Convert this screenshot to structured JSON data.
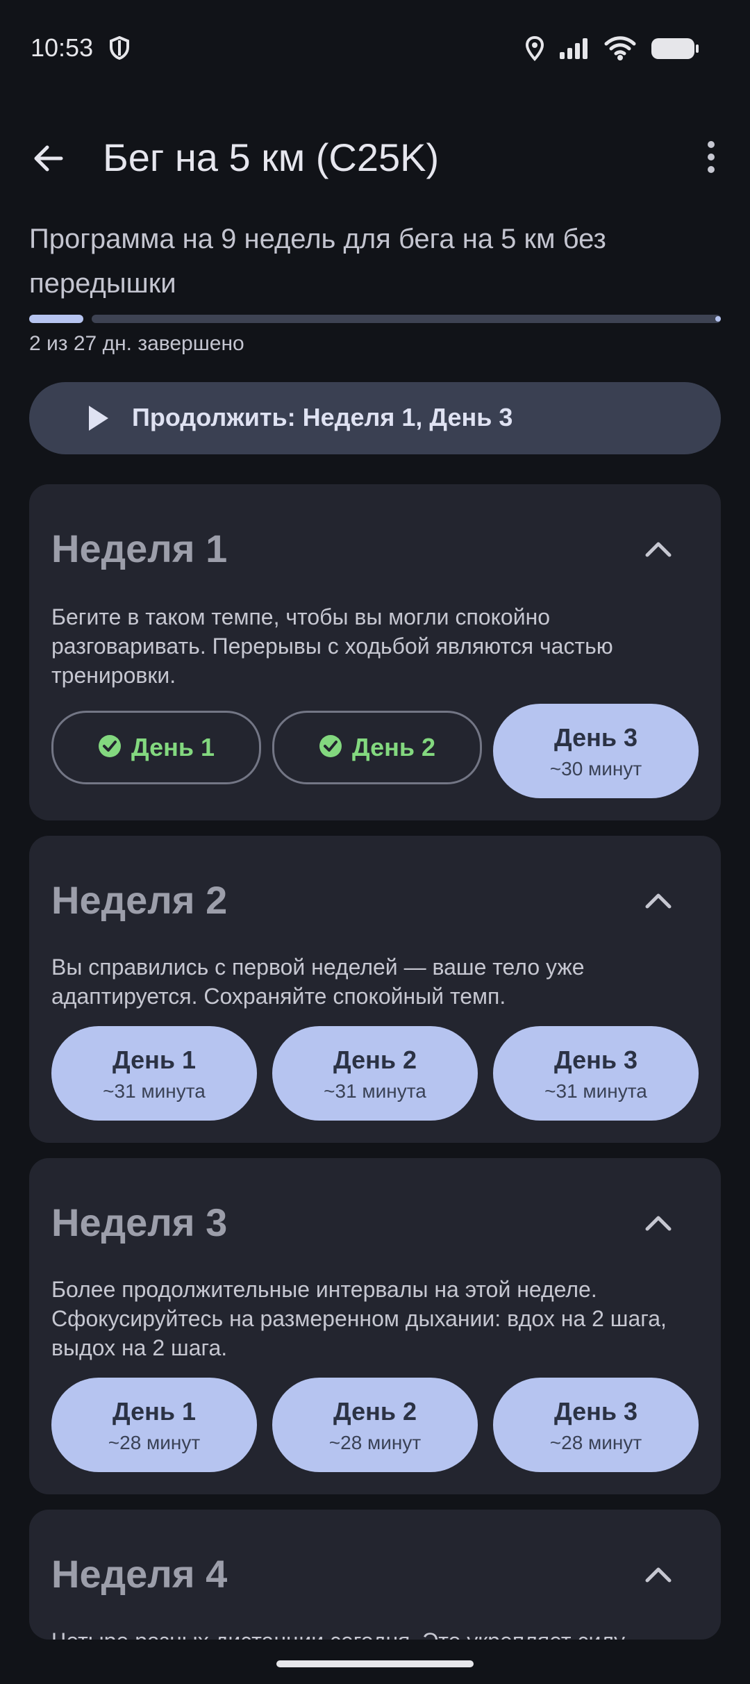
{
  "status_bar": {
    "time": "10:53",
    "icons": [
      "shield-icon",
      "location-icon",
      "signal-icon",
      "wifi-icon",
      "battery-icon"
    ]
  },
  "app_bar": {
    "title": "Бег на 5 км (C25K)",
    "back_icon": "arrow-back-icon",
    "menu_icon": "more-vert-icon"
  },
  "program": {
    "description": "Программа на 9 недель для бега на 5 км без передышки",
    "progress_text": "2 из 27 дн. завершено",
    "progress_fraction": 0.074
  },
  "continue_button": {
    "label": "Продолжить: Неделя 1, День 3",
    "icon": "play-icon"
  },
  "weeks": [
    {
      "title": "Неделя 1",
      "description": "Бегите в таком темпе, чтобы вы могли спокойно разговаривать. Перерывы с ходьбой являются частью тренировки.",
      "days": [
        {
          "label": "День 1",
          "duration": "",
          "completed": true
        },
        {
          "label": "День 2",
          "duration": "",
          "completed": true
        },
        {
          "label": "День 3",
          "duration": "~30 минут",
          "completed": false
        }
      ]
    },
    {
      "title": "Неделя 2",
      "description": "Вы справились с первой неделей — ваше тело уже адаптируется. Сохраняйте спокойный темп.",
      "days": [
        {
          "label": "День 1",
          "duration": "~31 минута",
          "completed": false
        },
        {
          "label": "День 2",
          "duration": "~31 минута",
          "completed": false
        },
        {
          "label": "День 3",
          "duration": "~31 минута",
          "completed": false
        }
      ]
    },
    {
      "title": "Неделя 3",
      "description": "Более продолжительные интервалы на этой неделе. Сфокусируйтесь на размеренном дыхании: вдох на 2 шага, выдох на 2 шага.",
      "days": [
        {
          "label": "День 1",
          "duration": "~28 минут",
          "completed": false
        },
        {
          "label": "День 2",
          "duration": "~28 минут",
          "completed": false
        },
        {
          "label": "День 3",
          "duration": "~28 минут",
          "completed": false
        }
      ]
    },
    {
      "title": "Неделя 4",
      "description": "Четыре разных дистанции сегодня. Это укрепляет силу"
    }
  ],
  "colors": {
    "background": "#111318",
    "card": "#23252f",
    "accent": "#b6c4f0",
    "completed_green": "#83d87f",
    "continue_button": "#3a4052"
  }
}
